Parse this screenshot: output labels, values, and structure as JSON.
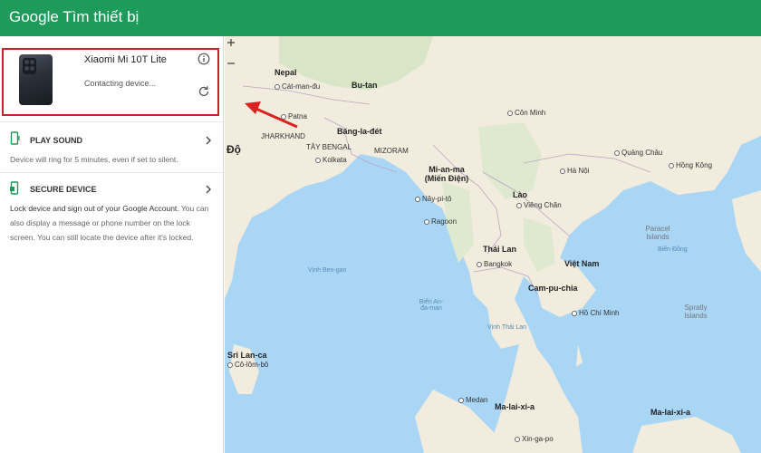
{
  "app": {
    "title": "Google Tìm thiết bị"
  },
  "device": {
    "name": "Xiaomi Mi 10T Lite",
    "status": "Contacting device..."
  },
  "actions": [
    {
      "label": "PLAY SOUND",
      "description": "Device will ring for 5 minutes, even if set to silent."
    },
    {
      "label": "SECURE DEVICE",
      "desc_bold": "Lock device and sign out of your Google Account.",
      "description": " You can also display a message or phone number on the lock screen. You can still locate the device after it's locked."
    }
  ],
  "map": {
    "labels": [
      {
        "name": "Nepal",
        "kind": "country"
      },
      {
        "name": "Cát-man-đu",
        "kind": "city"
      },
      {
        "name": "Bu-tan",
        "kind": "country"
      },
      {
        "name": "Patna",
        "kind": "city"
      },
      {
        "name": "JHARKHAND",
        "kind": "region"
      },
      {
        "name": "Băng-la-đét",
        "kind": "country"
      },
      {
        "name": "Độ",
        "kind": "country"
      },
      {
        "name": "TÂY BENGAL",
        "kind": "region"
      },
      {
        "name": "Kolkata",
        "kind": "city"
      },
      {
        "name": "MIZORAM",
        "kind": "region"
      },
      {
        "name": "Mi-an-ma (Miến Điện)",
        "kind": "country"
      },
      {
        "name": "Nây-pi-tô",
        "kind": "city"
      },
      {
        "name": "Ragoon",
        "kind": "city"
      },
      {
        "name": "Vịnh Ben-gan",
        "kind": "sea"
      },
      {
        "name": "Biển An-đa-man",
        "kind": "sea"
      },
      {
        "name": "Lào",
        "kind": "country"
      },
      {
        "name": "Viêng Chăn",
        "kind": "city"
      },
      {
        "name": "Thái Lan",
        "kind": "country"
      },
      {
        "name": "Bangkok",
        "kind": "city"
      },
      {
        "name": "Cam-pu-chia",
        "kind": "country"
      },
      {
        "name": "Việt Nam",
        "kind": "country"
      },
      {
        "name": "Hồ Chí Minh",
        "kind": "city"
      },
      {
        "name": "Vịnh Thái Lan",
        "kind": "sea"
      },
      {
        "name": "Côn Minh",
        "kind": "city"
      },
      {
        "name": "Hà Nội",
        "kind": "city"
      },
      {
        "name": "Quảng Châu",
        "kind": "city"
      },
      {
        "name": "Hồng Kông",
        "kind": "city"
      },
      {
        "name": "Sri Lan-ca",
        "kind": "country"
      },
      {
        "name": "Cô-lôm-bô",
        "kind": "city"
      },
      {
        "name": "Ma-lai-xi-a",
        "kind": "country"
      },
      {
        "name": "Medan",
        "kind": "city"
      },
      {
        "name": "Xin-ga-po",
        "kind": "city"
      },
      {
        "name": "Paracel Islands",
        "kind": "island"
      },
      {
        "name": "Spratly Islands",
        "kind": "island"
      },
      {
        "name": "Biển Đông",
        "kind": "sea"
      },
      {
        "name": "Ma-lai-xi-a",
        "kind": "country"
      }
    ]
  }
}
